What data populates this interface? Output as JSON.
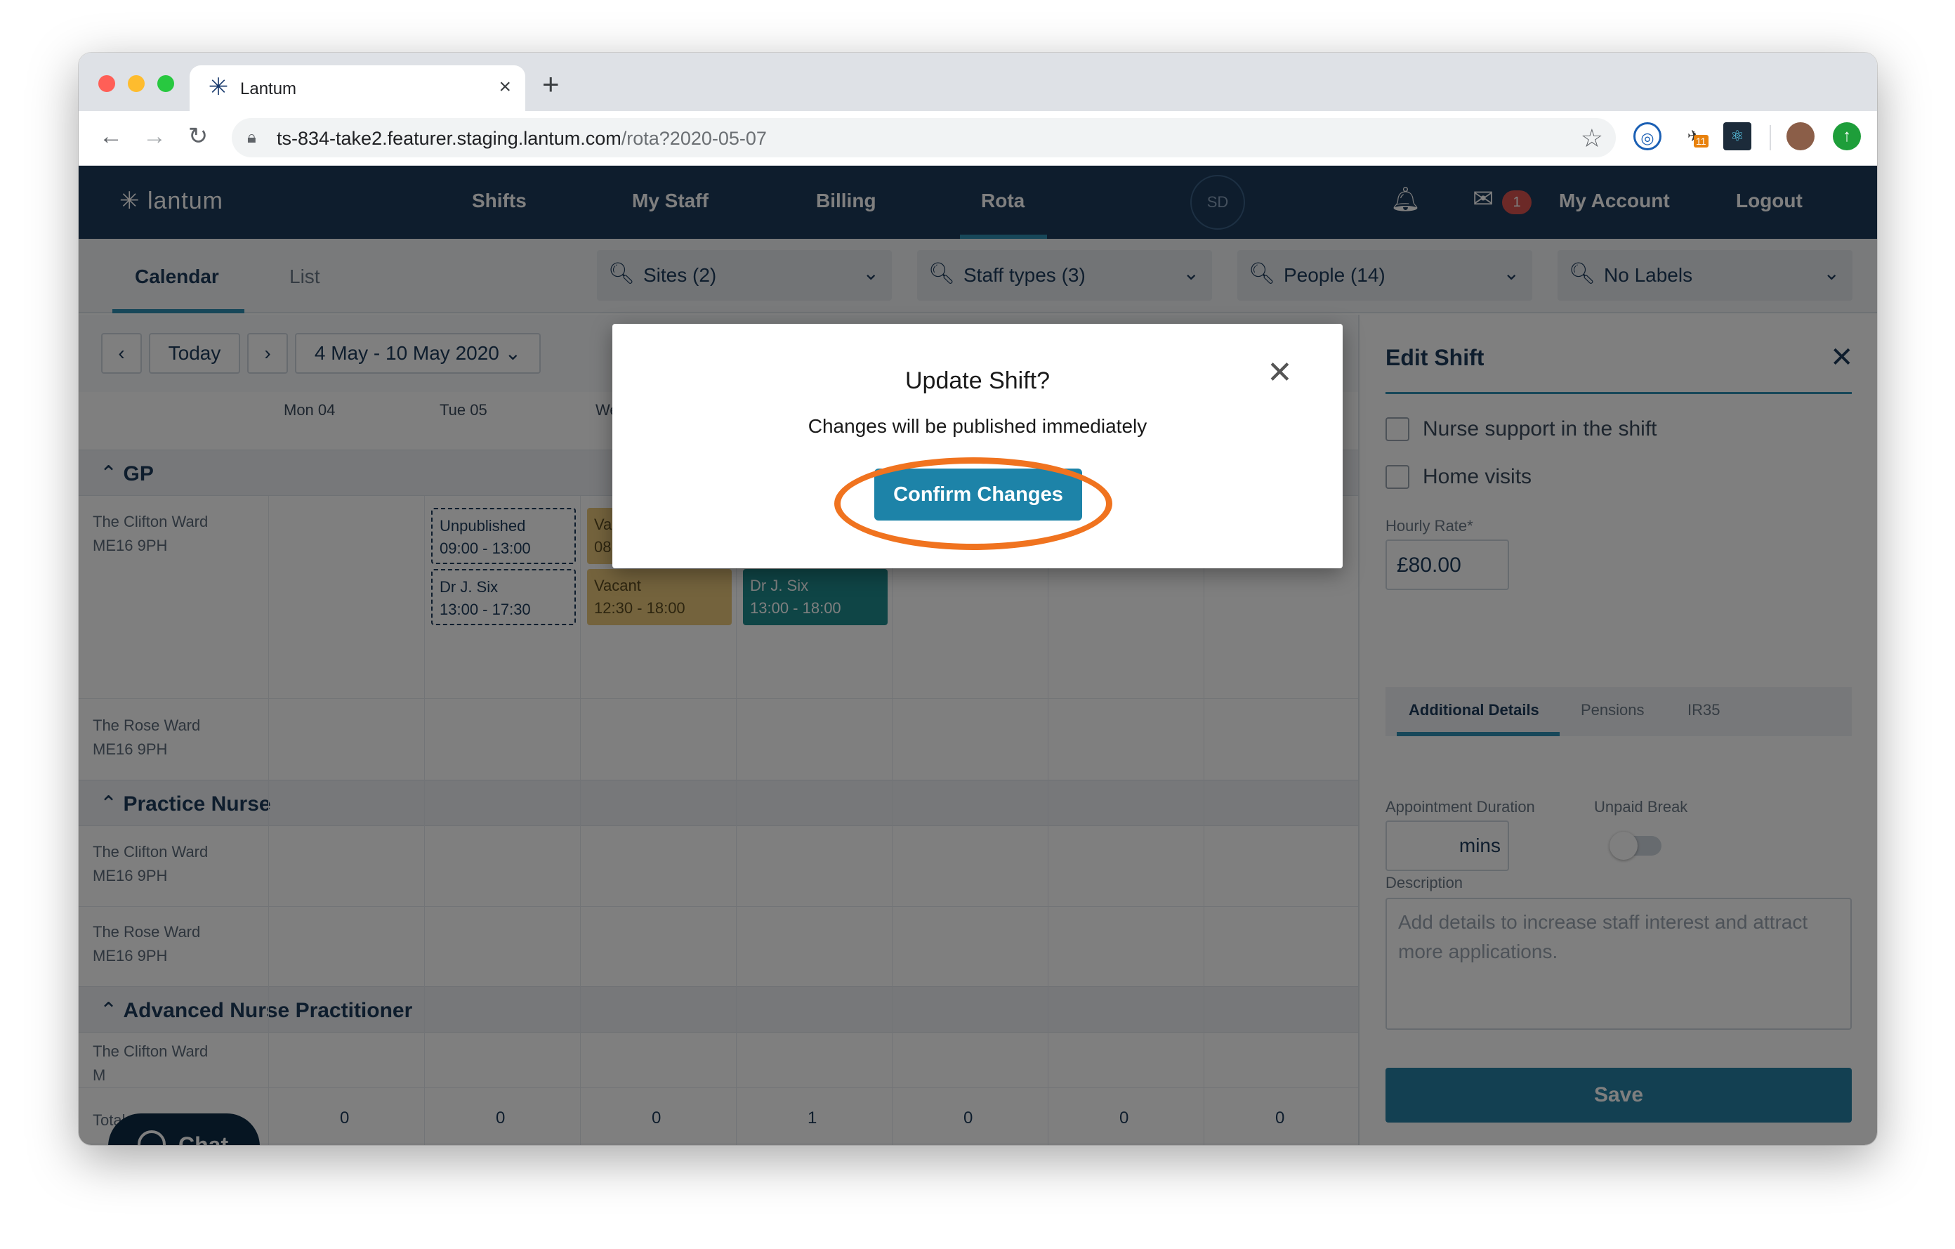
{
  "browser": {
    "tab_title": "Lantum",
    "tab_close": "×",
    "new_tab": "+",
    "url_host": "ts-834-take2.featurer.staging.lantum.com",
    "url_path": "/rota?2020-05-07",
    "extension_badge": "11"
  },
  "nav": {
    "brand": "lantum",
    "links": [
      "Shifts",
      "My Staff",
      "Billing",
      "Rota"
    ],
    "avatar_initials": "SD",
    "mail_count": "1",
    "my_account": "My Account",
    "logout": "Logout"
  },
  "subnav": {
    "tabs": [
      "Calendar",
      "List"
    ],
    "filters": [
      "Sites (2)",
      "Staff types (3)",
      "People (14)",
      "No Labels"
    ]
  },
  "calendar": {
    "today_label": "Today",
    "date_range": "4 May - 10 May 2020",
    "days": [
      "Mon 04",
      "Tue 05",
      "We"
    ],
    "groups": [
      {
        "title": "GP"
      },
      {
        "title": "Practice Nurse"
      },
      {
        "title": "Advanced Nurse Practitioner"
      }
    ],
    "rows": [
      {
        "name": "The Clifton Ward",
        "postcode": "ME16 9PH"
      },
      {
        "name": "The Rose Ward",
        "postcode": "ME16 9PH"
      },
      {
        "name": "The Clifton Ward",
        "postcode": "ME16 9PH"
      },
      {
        "name": "The Rose Ward",
        "postcode": "ME16 9PH"
      },
      {
        "name": "The Clifton Ward",
        "postcode": "M"
      }
    ],
    "shifts": [
      {
        "title": "Unpublished",
        "time": "09:00 - 13:00"
      },
      {
        "title": "Dr J. Six",
        "time": "13:00 - 17:30"
      },
      {
        "title": "Va",
        "time": "08"
      },
      {
        "title": "Vacant",
        "time": "12:30 - 18:00"
      },
      {
        "title": "Dr J. Six",
        "time": "13:00 - 18:00"
      }
    ],
    "totals_label": "Total Staff",
    "totals": [
      "0",
      "0",
      "0",
      "1",
      "0",
      "0",
      "0"
    ]
  },
  "panel": {
    "title": "Edit Shift",
    "checkbox_1": "Nurse support in the shift",
    "checkbox_2": "Home visits",
    "rate_label": "Hourly Rate*",
    "rate_value": "£80.00",
    "tabs": [
      "Additional Details",
      "Pensions",
      "IR35"
    ],
    "appointment_label": "Appointment Duration",
    "appointment_unit": "mins",
    "unpaid_break_label": "Unpaid Break",
    "unpaid_break_on": false,
    "description_label": "Description",
    "description_placeholder": "Add details to increase staff interest and attract more applications.",
    "save_label": "Save"
  },
  "modal": {
    "title": "Update Shift?",
    "subtitle": "Changes will be published immediately",
    "confirm_label": "Confirm Changes"
  },
  "chat": {
    "label": "Chat"
  },
  "colors": {
    "nav_bg": "#1d3a5a",
    "accent": "#2e8fb3",
    "confirm": "#1d83a8",
    "highlight_ring": "#f0731f",
    "vacant": "#e9c77a",
    "filled": "#1f8a8c"
  },
  "icons": {
    "search": "search-icon",
    "chevron": "chevron-down-icon",
    "bell": "bell-icon",
    "mail": "mail-icon",
    "close": "close-icon",
    "chat": "chat-bubble-icon"
  }
}
